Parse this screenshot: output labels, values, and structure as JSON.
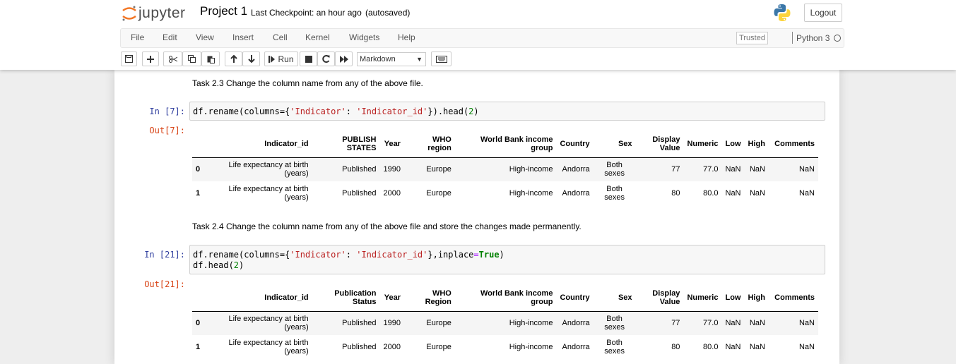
{
  "header": {
    "logo_text": "jupyter",
    "notebook_title": "Project 1",
    "checkpoint": "Last Checkpoint: an hour ago",
    "autosave": "(autosaved)",
    "logout_label": "Logout"
  },
  "menu": [
    "File",
    "Edit",
    "View",
    "Insert",
    "Cell",
    "Kernel",
    "Widgets",
    "Help"
  ],
  "status": {
    "trusted": "Trusted",
    "kernel": "Python 3"
  },
  "toolbar": {
    "run_label": "Run",
    "cell_type": "Markdown"
  },
  "colors": {
    "prompt_in": "#303f9f",
    "prompt_out": "#d84315",
    "string": "#ba2121",
    "number": "#008000"
  },
  "cells": [
    {
      "markdown": "Task 2.3 Change the column name from any of the above file.",
      "prompt_in": "In [7]:",
      "prompt_out": "Out[7]:",
      "table": {
        "headers": [
          "",
          "Indicator_id",
          "PUBLISH STATES",
          "Year",
          "WHO region",
          "World Bank income group",
          "Country",
          "Sex",
          "Display Value",
          "Numeric",
          "Low",
          "High",
          "Comments"
        ],
        "rows": [
          [
            "0",
            "Life expectancy at birth (years)",
            "Published",
            "1990",
            "Europe",
            "High-income",
            "Andorra",
            "Both sexes",
            "77",
            "77.0",
            "NaN",
            "NaN",
            "NaN"
          ],
          [
            "1",
            "Life expectancy at birth (years)",
            "Published",
            "2000",
            "Europe",
            "High-income",
            "Andorra",
            "Both sexes",
            "80",
            "80.0",
            "NaN",
            "NaN",
            "NaN"
          ]
        ]
      }
    },
    {
      "markdown": "Task 2.4 Change the column name from any of the above file and store the changes made permanently.",
      "prompt_in": "In [21]:",
      "prompt_out": "Out[21]:",
      "table": {
        "headers": [
          "",
          "Indicator_id",
          "Publication Status",
          "Year",
          "WHO Region",
          "World Bank income group",
          "Country",
          "Sex",
          "Display Value",
          "Numeric",
          "Low",
          "High",
          "Comments"
        ],
        "rows": [
          [
            "0",
            "Life expectancy at birth (years)",
            "Published",
            "1990",
            "Europe",
            "High-income",
            "Andorra",
            "Both sexes",
            "77",
            "77.0",
            "NaN",
            "NaN",
            "NaN"
          ],
          [
            "1",
            "Life expectancy at birth (years)",
            "Published",
            "2000",
            "Europe",
            "High-income",
            "Andorra",
            "Both sexes",
            "80",
            "80.0",
            "NaN",
            "NaN",
            "NaN"
          ]
        ]
      }
    }
  ],
  "code": {
    "c1_p1": "df.rename(columns={",
    "c1_s1": "'Indicator'",
    "c1_p2": ": ",
    "c1_s2": "'Indicator_id'",
    "c1_p3": "}).head(",
    "c1_n1": "2",
    "c1_p4": ")",
    "c2_p1": "df.rename(columns={",
    "c2_s1": "'Indicator'",
    "c2_p2": ": ",
    "c2_s2": "'Indicator_id'",
    "c2_p3": "},inplace",
    "c2_eq": "=",
    "c2_kw": "True",
    "c2_p4": ")",
    "c2_l2a": "df.head(",
    "c2_n1": "2",
    "c2_l2b": ")"
  }
}
